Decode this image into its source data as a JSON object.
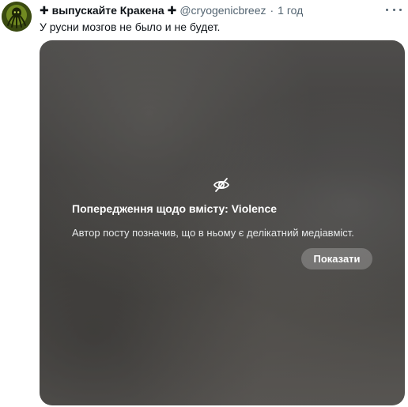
{
  "post": {
    "display_name": "✚ выпускайте Кракена ✚",
    "handle": "@cryogenicbreez",
    "separator": "·",
    "time": "1 год",
    "text": "У русни мозгов не было и не будет."
  },
  "media_warning": {
    "title": "Попередження щодо вмісту: Violence",
    "description": "Автор посту позначив, що в ньому є делікатний медіавміст.",
    "show_label": "Показати"
  },
  "icons": {
    "avatar": "kraken-avatar",
    "more": "more-horizontal-icon",
    "hidden": "eye-slash-icon"
  }
}
